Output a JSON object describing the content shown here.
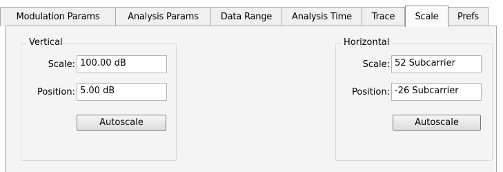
{
  "tabs": [
    {
      "label": "Modulation Params",
      "active": false
    },
    {
      "label": "Analysis Params",
      "active": false
    },
    {
      "label": "Data Range",
      "active": false
    },
    {
      "label": "Analysis Time",
      "active": false
    },
    {
      "label": "Trace",
      "active": false
    },
    {
      "label": "Scale",
      "active": true
    },
    {
      "label": "Prefs",
      "active": false
    }
  ],
  "vertical": {
    "title": "Vertical",
    "scale_label": "Scale:",
    "scale_value": "100.00 dB",
    "position_label": "Position:",
    "position_value": "5.00 dB",
    "autoscale_label": "Autoscale"
  },
  "horizontal": {
    "title": "Horizontal",
    "scale_label": "Scale:",
    "scale_value": "52 Subcarrier",
    "position_label": "Position:",
    "position_value": "-26 Subcarrier",
    "autoscale_label": "Autoscale"
  }
}
